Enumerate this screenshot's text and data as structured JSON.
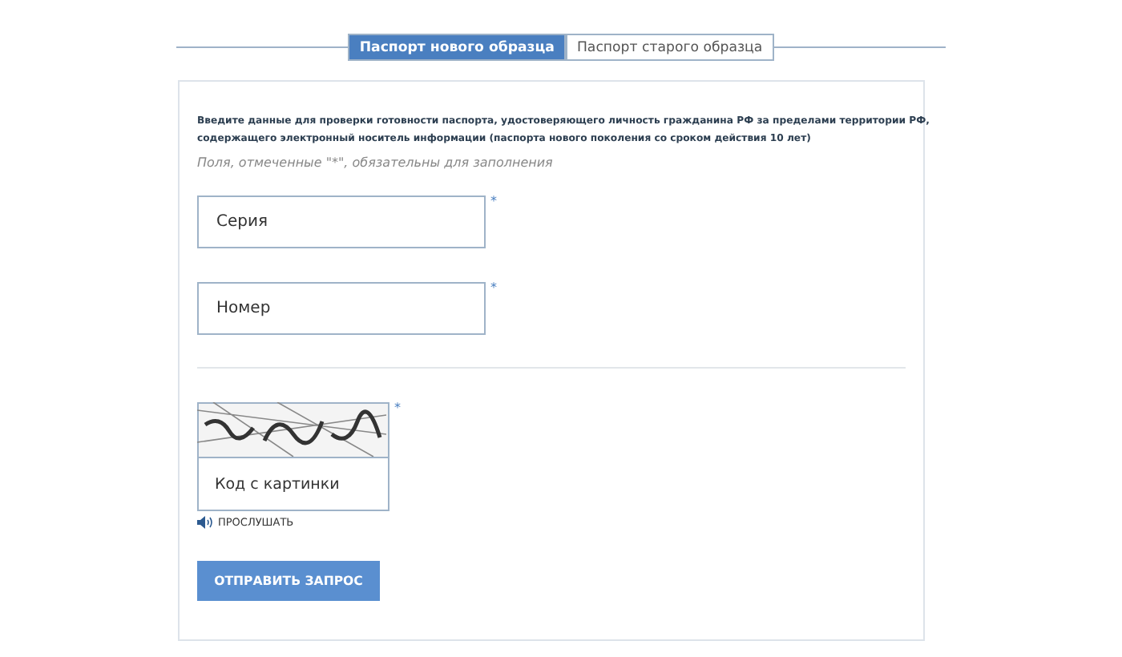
{
  "tabs": [
    {
      "label": "Паспорт нового образца",
      "selected": true
    },
    {
      "label": "Паспорт старого образца",
      "selected": false
    }
  ],
  "intro": "Введите данные для проверки готовности паспорта, удостоверяющего личность гражданина РФ за пределами территории РФ, содержащего электронный носитель информации (паспорта нового поколения со сроком действия 10 лет)",
  "required_note": "Поля, отмеченные \"*\", обязательны для заполнения",
  "fields": [
    {
      "placeholder": "Серия",
      "required_mark": "*"
    },
    {
      "placeholder": "Номер",
      "required_mark": "*"
    }
  ],
  "captcha": {
    "placeholder": "Код с картинки",
    "required_mark": "*",
    "listen": "ПРОСЛУШАТЬ"
  },
  "submit": "ОТПРАВИТЬ ЗАПРОС"
}
